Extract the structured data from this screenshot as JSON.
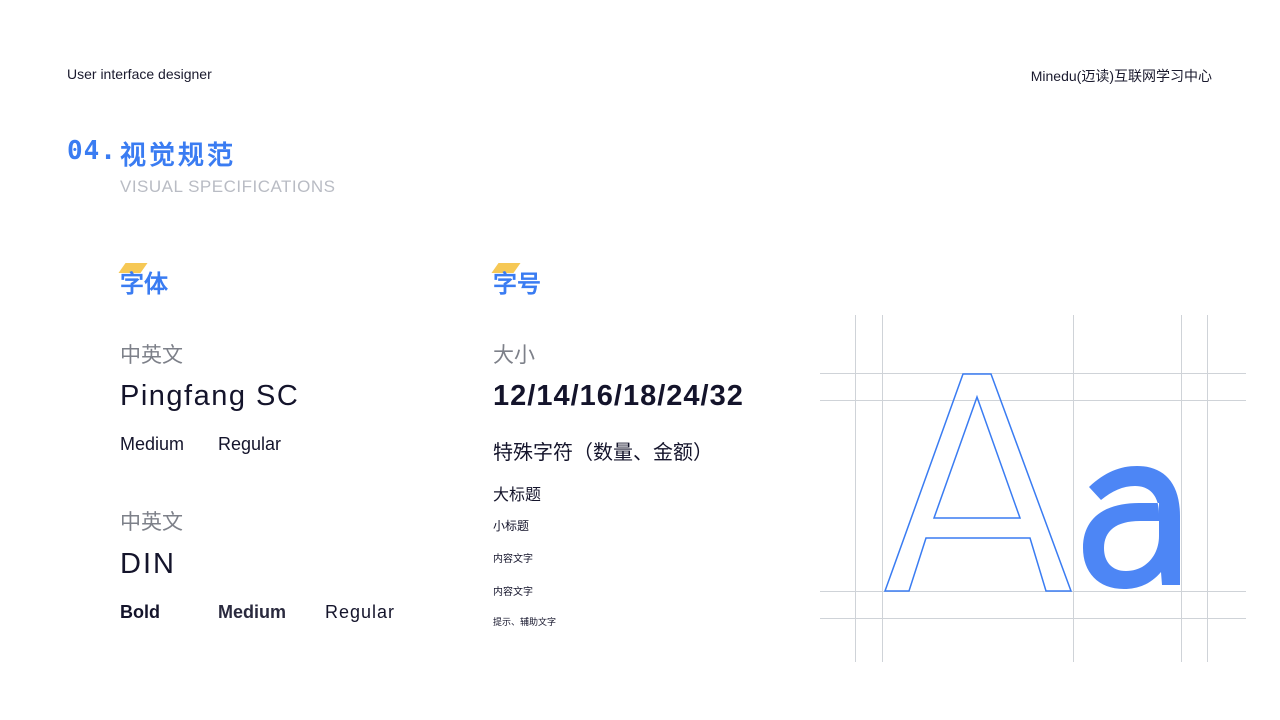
{
  "header": {
    "left": "User interface designer",
    "right": "Minedu(迈读)互联网学习中心"
  },
  "section": {
    "number": "04.",
    "title": "视觉规范",
    "subtitle": "VISUAL SPECIFICATIONS"
  },
  "fonts": {
    "heading": "字体",
    "groups": [
      {
        "label": "中英文",
        "family": "Pingfang SC",
        "weights": [
          "Medium",
          "Regular"
        ]
      },
      {
        "label": "中英文",
        "family": "DIN",
        "weights": [
          "Bold",
          "Medium",
          "Regular"
        ]
      }
    ]
  },
  "sizes": {
    "heading": "字号",
    "label": "大小",
    "values": "12/14/16/18/24/32",
    "samples": [
      {
        "text": "特殊字符（数量、金额）",
        "size": 24
      },
      {
        "text": "大标题",
        "size": 18
      },
      {
        "text": "小标题",
        "size": 14
      },
      {
        "text": "内容文字",
        "size": 12
      },
      {
        "text": "内容文字",
        "size": 12
      },
      {
        "text": "提示、辅助文字",
        "size": 11
      }
    ]
  },
  "glyph_sample": {
    "outline_letter": "A",
    "filled_letter": "a",
    "outline_color": "#3a7cf2",
    "fill_color": "#4d86f5"
  },
  "colors": {
    "accent": "#3a7cf2",
    "marker": "#f5c242",
    "muted": "#b9bcc4",
    "grey_label": "#7d8089",
    "grid": "#cfd3d8"
  }
}
